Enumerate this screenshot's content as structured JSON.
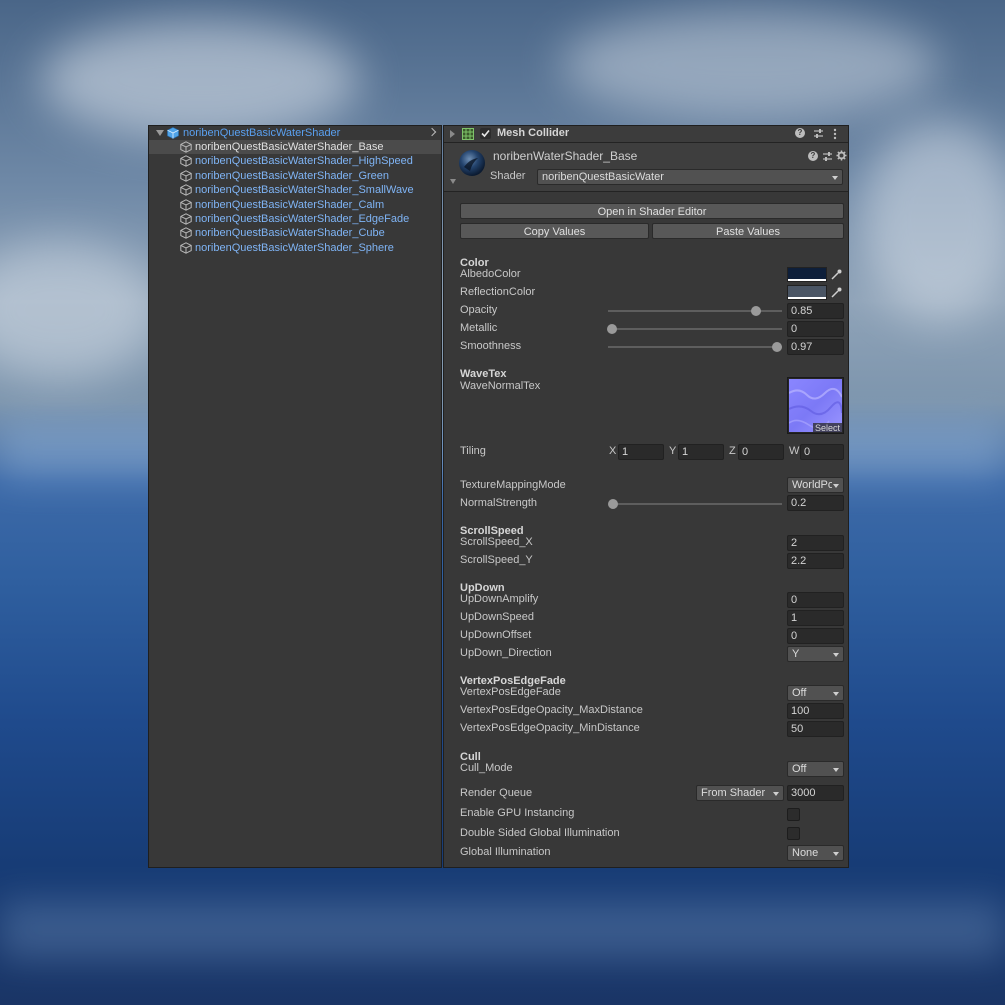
{
  "hierarchy": {
    "root": "noribenQuestBasicWaterShader",
    "items": [
      "noribenQuestBasicWaterShader_Base",
      "noribenQuestBasicWaterShader_HighSpeed",
      "noribenQuestBasicWaterShader_Green",
      "noribenQuestBasicWaterShader_SmallWave",
      "noribenQuestBasicWaterShader_Calm",
      "noribenQuestBasicWaterShader_EdgeFade",
      "noribenQuestBasicWaterShader_Cube",
      "noribenQuestBasicWaterShader_Sphere"
    ]
  },
  "inspector": {
    "component_title": "Mesh Collider",
    "material_name": "noribenWaterShader_Base",
    "shader_label": "Shader",
    "shader_value": "noribenQuestBasicWater",
    "open_editor": "Open in Shader Editor",
    "copy_values": "Copy Values",
    "paste_values": "Paste Values",
    "color_header": "Color",
    "albedo_label": "AlbedoColor",
    "reflection_label": "ReflectionColor",
    "opacity_label": "Opacity",
    "opacity_value": "0.85",
    "metallic_label": "Metallic",
    "metallic_value": "0",
    "smoothness_label": "Smoothness",
    "smoothness_value": "0.97",
    "wavetex_header": "WaveTex",
    "wavenormal_label": "WaveNormalTex",
    "select_label": "Select",
    "tiling_label": "Tiling",
    "tiling": {
      "x_label": "X",
      "x": "1",
      "y_label": "Y",
      "y": "1",
      "z_label": "Z",
      "z": "0",
      "w_label": "W",
      "w": "0"
    },
    "texmap_label": "TextureMappingMode",
    "texmap_value": "WorldPo",
    "normalstrength_label": "NormalStrength",
    "normalstrength_value": "0.2",
    "scroll_header": "ScrollSpeed",
    "scrollx_label": "ScrollSpeed_X",
    "scrollx_value": "2",
    "scrolly_label": "ScrollSpeed_Y",
    "scrolly_value": "2.2",
    "updown_header": "UpDown",
    "updown_amp_label": "UpDownAmplify",
    "updown_amp_value": "0",
    "updown_speed_label": "UpDownSpeed",
    "updown_speed_value": "1",
    "updown_offset_label": "UpDownOffset",
    "updown_offset_value": "0",
    "updown_dir_label": "UpDown_Direction",
    "updown_dir_value": "Y",
    "vpef_header": "VertexPosEdgeFade",
    "vpef_label": "VertexPosEdgeFade",
    "vpef_value": "Off",
    "vpef_max_label": "VertexPosEdgeOpacity_MaxDistance",
    "vpef_max_value": "100",
    "vpef_min_label": "VertexPosEdgeOpacity_MinDistance",
    "vpef_min_value": "50",
    "cull_header": "Cull",
    "cull_label": "Cull_Mode",
    "cull_value": "Off",
    "render_queue_label": "Render Queue",
    "render_queue_mode": "From Shader",
    "render_queue_value": "3000",
    "gpu_instancing_label": "Enable GPU Instancing",
    "double_sided_gi_label": "Double Sided Global Illumination",
    "global_illum_label": "Global Illumination",
    "global_illum_value": "None"
  },
  "sliders": {
    "opacity": 0.85,
    "metallic": 0,
    "smoothness": 0.97,
    "normalstrength": 0.02
  },
  "colors": {
    "albedo": "#0e1f3a",
    "reflection": "#4a5564",
    "link_blue": "#7fb4f5",
    "accent_blue": "#5aa0f0"
  },
  "icons": [
    "cube-icon",
    "prefab-icon",
    "mesh-grid-icon",
    "checkmark-icon",
    "help-icon",
    "preset-icon",
    "kebab-menu-icon",
    "gear-icon",
    "eyedropper-icon",
    "shader-ball-icon",
    "chevron-right-icon"
  ]
}
